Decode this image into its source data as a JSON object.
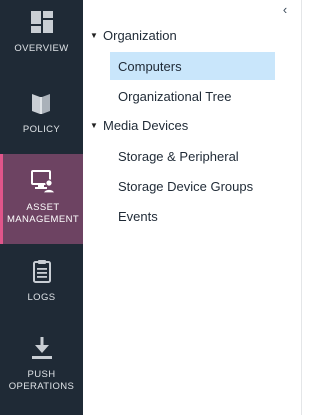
{
  "nav": {
    "items": [
      {
        "label": "OVERVIEW",
        "icon": "overview-grid-icon"
      },
      {
        "label": "POLICY",
        "icon": "policy-book-icon"
      },
      {
        "label": "ASSET MANAGEMENT",
        "label_lines": [
          "ASSET",
          "MANAGEMENT"
        ],
        "icon": "asset-monitor-user-icon",
        "active": true
      },
      {
        "label": "LOGS",
        "icon": "logs-clipboard-icon"
      },
      {
        "label": "PUSH OPERATIONS",
        "label_lines": [
          "PUSH",
          "OPERATIONS"
        ],
        "icon": "push-download-icon"
      }
    ]
  },
  "tree": {
    "collapse_glyph": "‹",
    "groups": [
      {
        "label": "Organization",
        "expanded": true,
        "children": [
          {
            "label": "Computers",
            "selected": true
          },
          {
            "label": "Organizational Tree",
            "selected": false
          }
        ]
      },
      {
        "label": "Media Devices",
        "expanded": true,
        "children": [
          {
            "label": "Storage & Peripheral",
            "selected": false
          },
          {
            "label": "Storage Device Groups",
            "selected": false
          },
          {
            "label": "Events",
            "selected": false
          }
        ]
      }
    ]
  },
  "colors": {
    "rail_bg": "#1f2a36",
    "active_bg": "#6d4362",
    "active_accent": "#e0558a",
    "selected_bg": "#c9e6fb"
  }
}
